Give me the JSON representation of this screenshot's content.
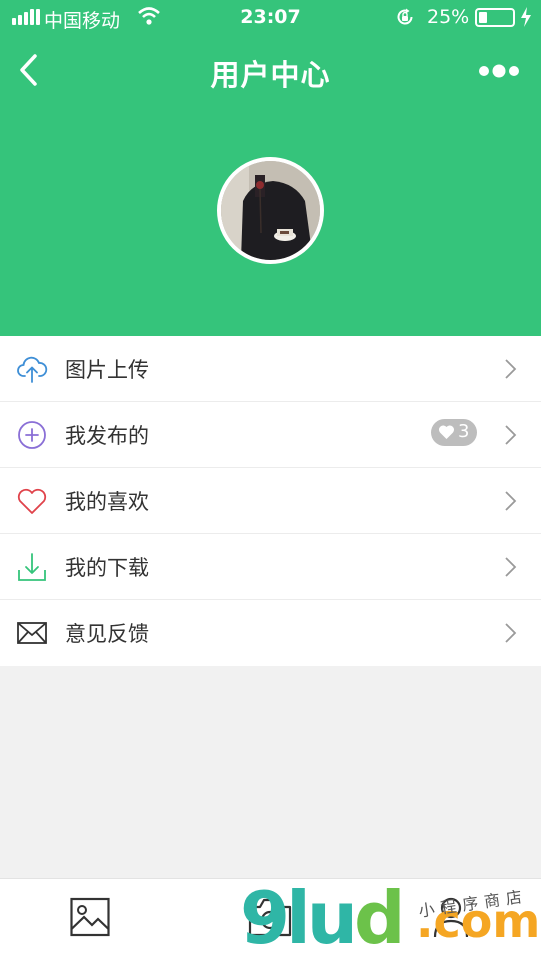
{
  "status_bar": {
    "carrier": "中国移动",
    "time": "23:07",
    "battery_percent": "25%",
    "battery_level": 0.25
  },
  "nav": {
    "title": "用户中心",
    "back_icon": "chevron-left-icon",
    "more_icon": "more-dots-icon"
  },
  "menu": {
    "items": [
      {
        "label": "图片上传",
        "icon": "cloud-upload-icon"
      },
      {
        "label": "我发布的",
        "icon": "plus-circle-icon",
        "badge": "3"
      },
      {
        "label": "我的喜欢",
        "icon": "heart-icon"
      },
      {
        "label": "我的下载",
        "icon": "download-icon"
      },
      {
        "label": "意见反馈",
        "icon": "mail-icon"
      }
    ]
  },
  "tabbar": {
    "tabs": [
      {
        "icon": "image-icon"
      },
      {
        "icon": "camera-icon"
      },
      {
        "icon": "user-icon"
      }
    ]
  },
  "watermark": {
    "main_left": "9lu",
    "main_right": "d",
    "suffix": ".com",
    "small": "小程序商店"
  },
  "colors": {
    "primary": "#35c47b",
    "background": "#f1f1f1",
    "upload_icon": "#3f8fd6",
    "publish_icon": "#8a6fd6",
    "heart_icon": "#e0434b",
    "download_icon": "#35c47b",
    "badge": "#bdbdbd"
  }
}
